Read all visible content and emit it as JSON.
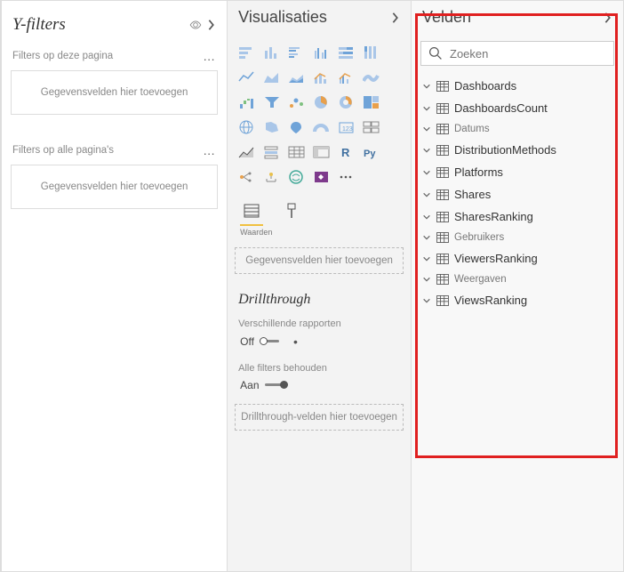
{
  "filters": {
    "title": "Y-filters",
    "sections": [
      {
        "label": "Filters op deze pagina",
        "placeholder": "Gegevensvelden hier toevoegen"
      },
      {
        "label": "Filters op alle pagina's",
        "placeholder": "Gegevensvelden hier toevoegen"
      }
    ]
  },
  "viz": {
    "title": "Visualisaties",
    "tab_label": "Waarden",
    "values_placeholder": "Gegevensvelden hier toevoegen",
    "drill": {
      "title": "Drillthrough",
      "cross_label": "Verschillende rapporten",
      "cross_value": "Off",
      "keep_label": "Alle filters behouden",
      "keep_value": "Aan",
      "placeholder": "Drillthrough-velden hier toevoegen"
    }
  },
  "fields": {
    "title": "Velden",
    "search_placeholder": "Zoeken",
    "items": [
      {
        "label": "Dashboards",
        "small": false
      },
      {
        "label": "DashboardsCount",
        "small": false
      },
      {
        "label": "Datums",
        "small": true
      },
      {
        "label": "DistributionMethods",
        "small": false
      },
      {
        "label": "Platforms",
        "small": false
      },
      {
        "label": "Shares",
        "small": false
      },
      {
        "label": "SharesRanking",
        "small": false
      },
      {
        "label": "Gebruikers",
        "small": true
      },
      {
        "label": "ViewersRanking",
        "small": false
      },
      {
        "label": "Weergaven",
        "small": true
      },
      {
        "label": "ViewsRanking",
        "small": false
      }
    ]
  },
  "chart_data": {
    "type": "table",
    "title": "Velden (data tables list)",
    "categories": [
      "Dashboards",
      "DashboardsCount",
      "Datums",
      "DistributionMethods",
      "Platforms",
      "Shares",
      "SharesRanking",
      "Gebruikers",
      "ViewersRanking",
      "Weergaven",
      "ViewsRanking"
    ]
  }
}
